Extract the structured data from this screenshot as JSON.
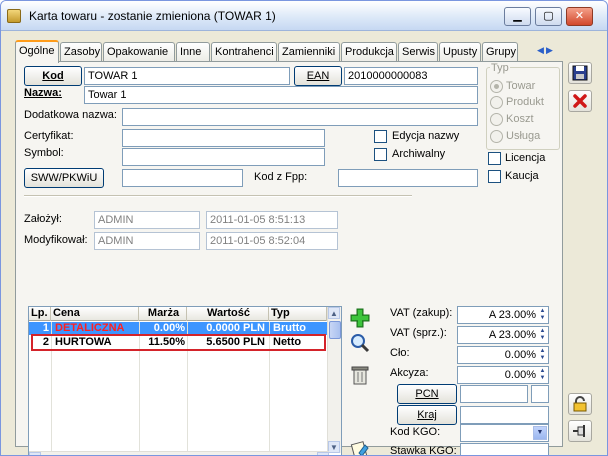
{
  "window": {
    "title": "Karta towaru - zostanie zmieniona (TOWAR 1)",
    "minimize": "▁",
    "maximize": "▢",
    "close": "✕"
  },
  "tabs": [
    "Ogólne",
    "Zasoby",
    "Opakowanie",
    "Inne",
    "Kontrahenci",
    "Zamienniki",
    "Produkcja",
    "Serwis",
    "Upusty",
    "Grupy"
  ],
  "tab_scroll": {
    "left": "◀",
    "right": "▶"
  },
  "form": {
    "kod_label": "Kod",
    "kod_value": "TOWAR 1",
    "ean_label": "EAN",
    "ean_value": "2010000000083",
    "nazwa_label": "Nazwa:",
    "nazwa_value": "Towar 1",
    "dodatkowa_label": "Dodatkowa nazwa:",
    "dodatkowa_value": "",
    "certyfikat_label": "Certyfikat:",
    "certyfikat_value": "",
    "symbol_label": "Symbol:",
    "symbol_value": "",
    "edycja_label": "Edycja nazwy",
    "archiwalny_label": "Archiwalny",
    "sww_label": "SWW/PKWiU",
    "sww_value": "",
    "kod_fpp_label": "Kod z Fpp:",
    "kod_fpp_value": ""
  },
  "typ_group": {
    "title": "Typ",
    "options": [
      "Towar",
      "Produkt",
      "Koszt",
      "Usługa"
    ]
  },
  "licencja_label": "Licencja",
  "kaucja_label": "Kaucja",
  "audit": {
    "zalozyl_label": "Założył:",
    "zalozyl_user": "ADMIN",
    "zalozyl_date": "2011-01-05  8:51:13",
    "modyfikowal_label": "Modyfikował:",
    "modyfikowal_user": "ADMIN",
    "modyfikowal_date": "2011-01-05  8:52:04"
  },
  "price_table": {
    "columns": [
      "Lp.",
      "Cena",
      "Marża",
      "Wartość",
      "Typ"
    ],
    "rows": [
      {
        "lp": "1",
        "cena": "DETALICZNA",
        "marza": "0.00%",
        "wartosc": "0.0000 PLN",
        "typ": "Brutto"
      },
      {
        "lp": "2",
        "cena": "HURTOWA",
        "marza": "11.50%",
        "wartosc": "5.6500 PLN",
        "typ": "Netto"
      }
    ],
    "scroll_up": "▲",
    "scroll_down": "▼",
    "scroll_left": "◀",
    "scroll_right": "▶"
  },
  "tax": {
    "vat_zakup_label": "VAT (zakup):",
    "vat_zakup_value": "A 23.00%",
    "vat_sprz_label": "VAT (sprz.):",
    "vat_sprz_value": "A 23.00%",
    "clo_label": "Cło:",
    "clo_value": "0.00%",
    "akcyza_label": "Akcyza:",
    "akcyza_value": "0.00%",
    "pcn_label": "PCN",
    "kraj_label": "Kraj",
    "kod_kgo_label": "Kod KGO:",
    "stawka_kgo_label": "Stawka KGO:"
  },
  "colors": {
    "accent_tab": "#ff9c1a",
    "selected_row": "#3d95ff",
    "detail_text": "#ff2020",
    "highlight_box": "#d4232a"
  }
}
